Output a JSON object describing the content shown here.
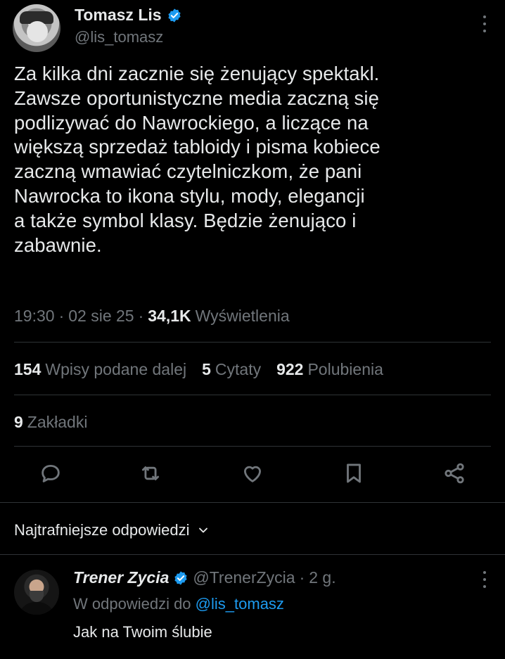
{
  "tweet": {
    "author": {
      "name": "Tomasz Lis",
      "handle": "@lis_tomasz",
      "verified": true
    },
    "text": "Za kilka dni zacznie się żenujący spektakl.\nZawsze oportunistyczne media zaczną się\npodlizywać do Nawrockiego, a liczące na\nwiększą sprzedaż  tabloidy i pisma kobiece\nzaczną wmawiać czytelniczkom, że pani\nNawrocka to ikona stylu, mody, elegancji\na także symbol klasy. Będzie żenująco i\nzabawnie.",
    "time": "19:30",
    "date": "02 sie 25",
    "views_count": "34,1K",
    "views_label": "Wyświetlenia",
    "separator": "·"
  },
  "stats": {
    "retweets_count": "154",
    "retweets_label": "Wpisy podane dalej",
    "quotes_count": "5",
    "quotes_label": "Cytaty",
    "likes_count": "922",
    "likes_label": "Polubienia",
    "bookmarks_count": "9",
    "bookmarks_label": "Zakładki"
  },
  "actions": [
    "reply-icon",
    "retweet-icon",
    "like-icon",
    "bookmark-icon",
    "share-icon"
  ],
  "replies": {
    "header": "Najtrafniejsze odpowiedzi",
    "items": [
      {
        "name": "Trener Zycia",
        "handle": "@TrenerZycia",
        "age": "2 g.",
        "reply_to_prefix": "W odpowiedzi do",
        "reply_to_handle": "@lis_tomasz",
        "text": "Jak na Twoim ślubie"
      }
    ]
  },
  "colors": {
    "background": "#000000",
    "text": "#e7e9ea",
    "muted": "#71767b",
    "accent": "#1d9bf0",
    "divider": "#2f3336"
  }
}
